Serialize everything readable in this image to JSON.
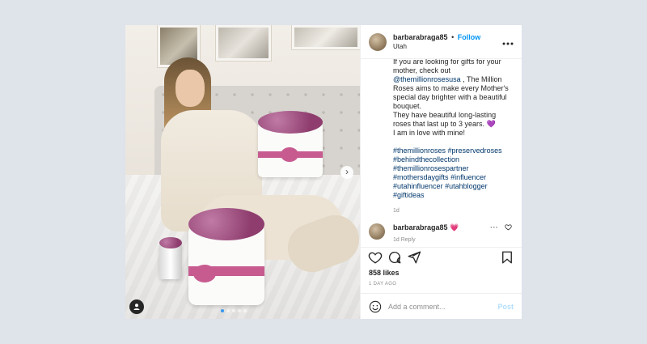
{
  "post": {
    "username": "barbarabraga85",
    "separator": "•",
    "follow_label": "Follow",
    "location": "Utah",
    "caption": {
      "line1": "If you are looking for gifts for your",
      "line2": "mother, check out",
      "mention": "@themillionrosesusa",
      "line3_rest": " , The Million",
      "line4": "Roses aims to make every Mother's",
      "line5": "special day brighter with a beautiful",
      "line6": "bouquet.",
      "line7": "They have beautiful long-lasting",
      "line8": "roses that last up to 3 years. 💜",
      "line9": "I am in love with mine!"
    },
    "hashtags": {
      "t1": "#themillionroses",
      "t2": "#preservedroses",
      "t3": "#behindthecollection",
      "t4": "#themillionrosespartner",
      "t5": "#mothersdaygifts",
      "t6": "#influencer",
      "t7": "#utahinfluencer",
      "t8": "#utahblogger",
      "t9": "#giftideas"
    },
    "caption_time": "1d",
    "comment": {
      "username": "barbarabraga85",
      "emoji": "💗",
      "meta": "1d   Reply"
    },
    "likes": "858 likes",
    "date": "1 DAY AGO",
    "add_comment_placeholder": "Add a comment...",
    "post_label": "Post"
  },
  "colors": {
    "link": "#00376b",
    "follow": "#0095f6",
    "highlight": "#00e0ff",
    "muted": "#8e8e8e"
  },
  "icons": [
    "more-horizontal-icon",
    "heart-icon",
    "comment-icon",
    "share-icon",
    "bookmark-icon",
    "emoji-icon",
    "chevron-right-icon",
    "user-tag-icon"
  ]
}
